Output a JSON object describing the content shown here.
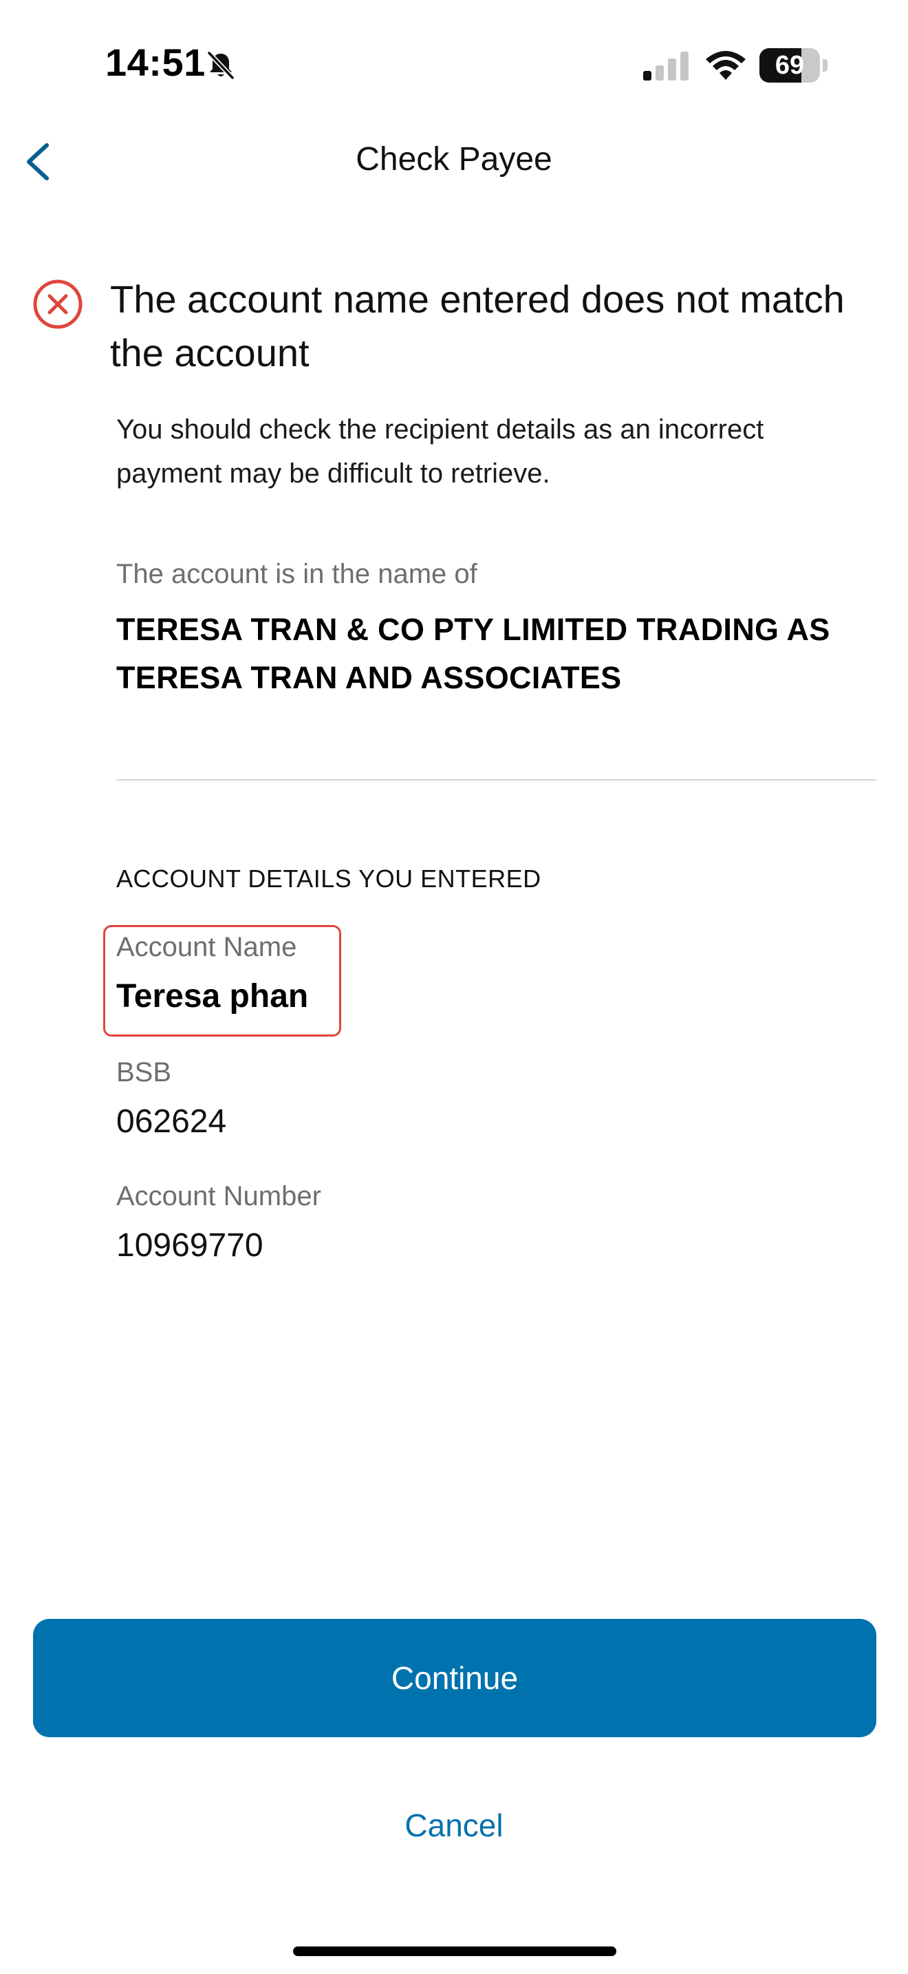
{
  "status_bar": {
    "time": "14:51",
    "battery_level": "69",
    "battery_fraction": 0.69,
    "signal_bars_active": 1,
    "icons": [
      "bell-slash-icon",
      "signal-icon",
      "wifi-icon",
      "battery-icon"
    ]
  },
  "nav": {
    "title": "Check Payee",
    "back_icon": "chevron-left-icon"
  },
  "alert": {
    "icon": "error-circle-x-icon",
    "title": "The account name entered does not match the account",
    "description": "You should check the recipient details as an incorrect payment may be difficult to retrieve."
  },
  "account_holder": {
    "label": "The account is in the name of",
    "name": "TERESA TRAN & CO PTY LIMITED TRADING AS TERESA TRAN AND ASSOCIATES"
  },
  "entered_details": {
    "heading": "ACCOUNT DETAILS YOU ENTERED",
    "account_name_label": "Account Name",
    "account_name_value": "Teresa phan",
    "bsb_label": "BSB",
    "bsb_value": "062624",
    "account_number_label": "Account Number",
    "account_number_value": "10969770"
  },
  "actions": {
    "continue_label": "Continue",
    "cancel_label": "Cancel"
  },
  "colors": {
    "accent": "#0072ae",
    "error": "#e0453c",
    "secondary_text": "#6d6d72"
  }
}
